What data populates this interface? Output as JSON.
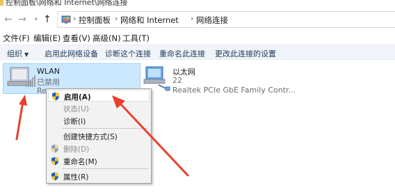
{
  "window": {
    "title": "控制面板\\网络和 Internet\\网络连接"
  },
  "nav": {
    "back_icon": "back-arrow-icon",
    "forward_icon": "forward-arrow-icon",
    "recent_icon": "chevron-down-icon",
    "up_icon": "up-arrow-icon"
  },
  "address": {
    "crumbs": [
      "控制面板",
      "网络和 Internet",
      "网络连接"
    ]
  },
  "menubar": {
    "items": [
      "文件(F)",
      "编辑(E)",
      "查看(V)",
      "高级(N)",
      "工具(T)"
    ]
  },
  "commandbar": {
    "organize": "组织",
    "items": [
      "启用此网络设备",
      "诊断这个连接",
      "重命名此连接",
      "更改此连接的设置"
    ]
  },
  "adapters": [
    {
      "name": "WLAN",
      "status": "已禁用",
      "desc": "Re",
      "icon": "wifi-adapter-icon",
      "selected": true
    },
    {
      "name": "以太网",
      "status": "22",
      "desc": "Realtek PCIe GbE Family Contr...",
      "icon": "ethernet-adapter-icon",
      "selected": false
    }
  ],
  "context_menu": {
    "items": [
      {
        "label": "启用(A)",
        "shield": true,
        "disabled": false,
        "bold": true,
        "highlighted": true
      },
      {
        "label": "状态(U)",
        "shield": false,
        "disabled": true,
        "bold": false,
        "highlighted": false
      },
      {
        "label": "诊断(I)",
        "shield": false,
        "disabled": false,
        "bold": false,
        "highlighted": false
      },
      {
        "label": "创建快捷方式(S)",
        "shield": false,
        "disabled": false,
        "bold": false,
        "highlighted": false
      },
      {
        "label": "删除(D)",
        "shield": true,
        "disabled": true,
        "bold": false,
        "highlighted": false
      },
      {
        "label": "重命名(M)",
        "shield": true,
        "disabled": false,
        "bold": false,
        "highlighted": false
      },
      {
        "label": "属性(R)",
        "shield": true,
        "disabled": false,
        "bold": false,
        "highlighted": false
      }
    ]
  },
  "colors": {
    "selection_fill": "#cce8ff",
    "selection_border": "#99d1ff",
    "arrow": "#e8402c",
    "commandbar_text": "#1e395b"
  }
}
